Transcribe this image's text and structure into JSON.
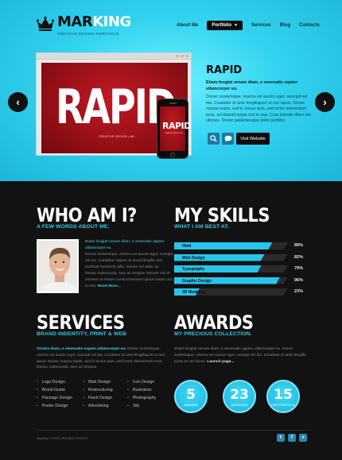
{
  "header": {
    "logo_a": "MAR",
    "logo_b": "KING",
    "tagline": "CREATIVE DESIGN PORTFOLIO",
    "nav": [
      "About Me",
      "Portfolio",
      "Services",
      "Blog",
      "Contacts"
    ]
  },
  "slider": {
    "image_word": "RAPID",
    "image_sub": "CREATIVE DESIGN LAB",
    "title": "RAPID",
    "lead": "Etiam feugiat ornare diam, a venenatis sapien ullamcorper eu.",
    "text": "Donec scelerisque, viverra vel auctor eget, suscipit vel dui. Curabitur id ante fringillaport ut nec lacus. Donec massa turpis, sed in luctus quis, sed tortor elementum eros, vel blandit turpis orci in risa. Cras lobortis diam vel ultrices. Donec pellentesque dolor porttitor.",
    "visit_label": "Visit Website"
  },
  "who": {
    "title": "WHO AM I?",
    "subtitle": "A FEW WORDS ABOUT ME.",
    "lead": "Etiam feugiat ornare diam, a venenatis sapien ullamcorper eu.",
    "text1": "Donec scelerisque, viverra vel auctor eget, suscipit vel dui. Curabitur sapien at tincid fringilla orci portituor hendrerit odio. Donec vel dolor ac.",
    "text2": "Donec malesuada, sem ac tempus lobortis nisl et. Aenean ut metus curab emessent ipsum turpis orci in risa.",
    "more": "Read More..."
  },
  "skills": {
    "title": "MY SKILLS",
    "subtitle": "WHAT I AM BEST AT.",
    "items": [
      {
        "name": "Html",
        "percent": 89,
        "label": "89%"
      },
      {
        "name": "Web Design",
        "percent": 82,
        "label": "82%"
      },
      {
        "name": "Typography",
        "percent": 79,
        "label": "79%"
      },
      {
        "name": "Graphic Design",
        "percent": 96,
        "label": "96%"
      },
      {
        "name": "3D Modeling",
        "percent": 23,
        "label": "23%"
      }
    ]
  },
  "services": {
    "title": "SERVICES",
    "subtitle": "BRAND INDENTITY, PRINT & WEB",
    "lead": "Ornare diam, a venenatis sapien ullamcorper eu.",
    "text": "Donec scelerisque, viverra vel auctor eget, suscipit vel dui. Curabitur id ante fringillaport ut nec lacus. Donec massa turpis, sed in luctus quis, sed tortor elementum eros. Donec malesuada, sem ac tempus.",
    "col1": [
      "Logo Design",
      "Brand Guide",
      "Package Design",
      "Poster Design"
    ],
    "col2": [
      "Web Design",
      "Restructuring",
      "Flash Design",
      "Advertising"
    ],
    "col3": [
      "Icon Design",
      "Illustration",
      "Photography",
      "3ds"
    ]
  },
  "awards": {
    "title": "AWARDS",
    "subtitle": "MY PRECIOUS COLLECTION.",
    "text": "Etiam feugiat ornare diam, a venenatis sapien ullamcorper eu. Donec scelerisque, viverra vel auctor eget, suscipit vel dui. Curabitur id ante fringilla porta ut nec lacus.",
    "launch": "Launch page...",
    "badges": [
      {
        "num": "5",
        "label": "AWARDS"
      },
      {
        "num": "23",
        "label": "ARTICLES"
      },
      {
        "num": "15",
        "label": "CSS PORTALS"
      }
    ]
  },
  "footer": {
    "copy": "Marking © 2012 | PRIVACY POLICY",
    "social": [
      "twitter-icon",
      "facebook-icon",
      "rss-icon"
    ],
    "social_glyphs": [
      "t",
      "f",
      "»"
    ]
  },
  "colors": {
    "accent": "#29c4ea",
    "hero_bg": "#33d3f0",
    "dark_bg": "#121212",
    "brand_red": "#b5121b"
  }
}
